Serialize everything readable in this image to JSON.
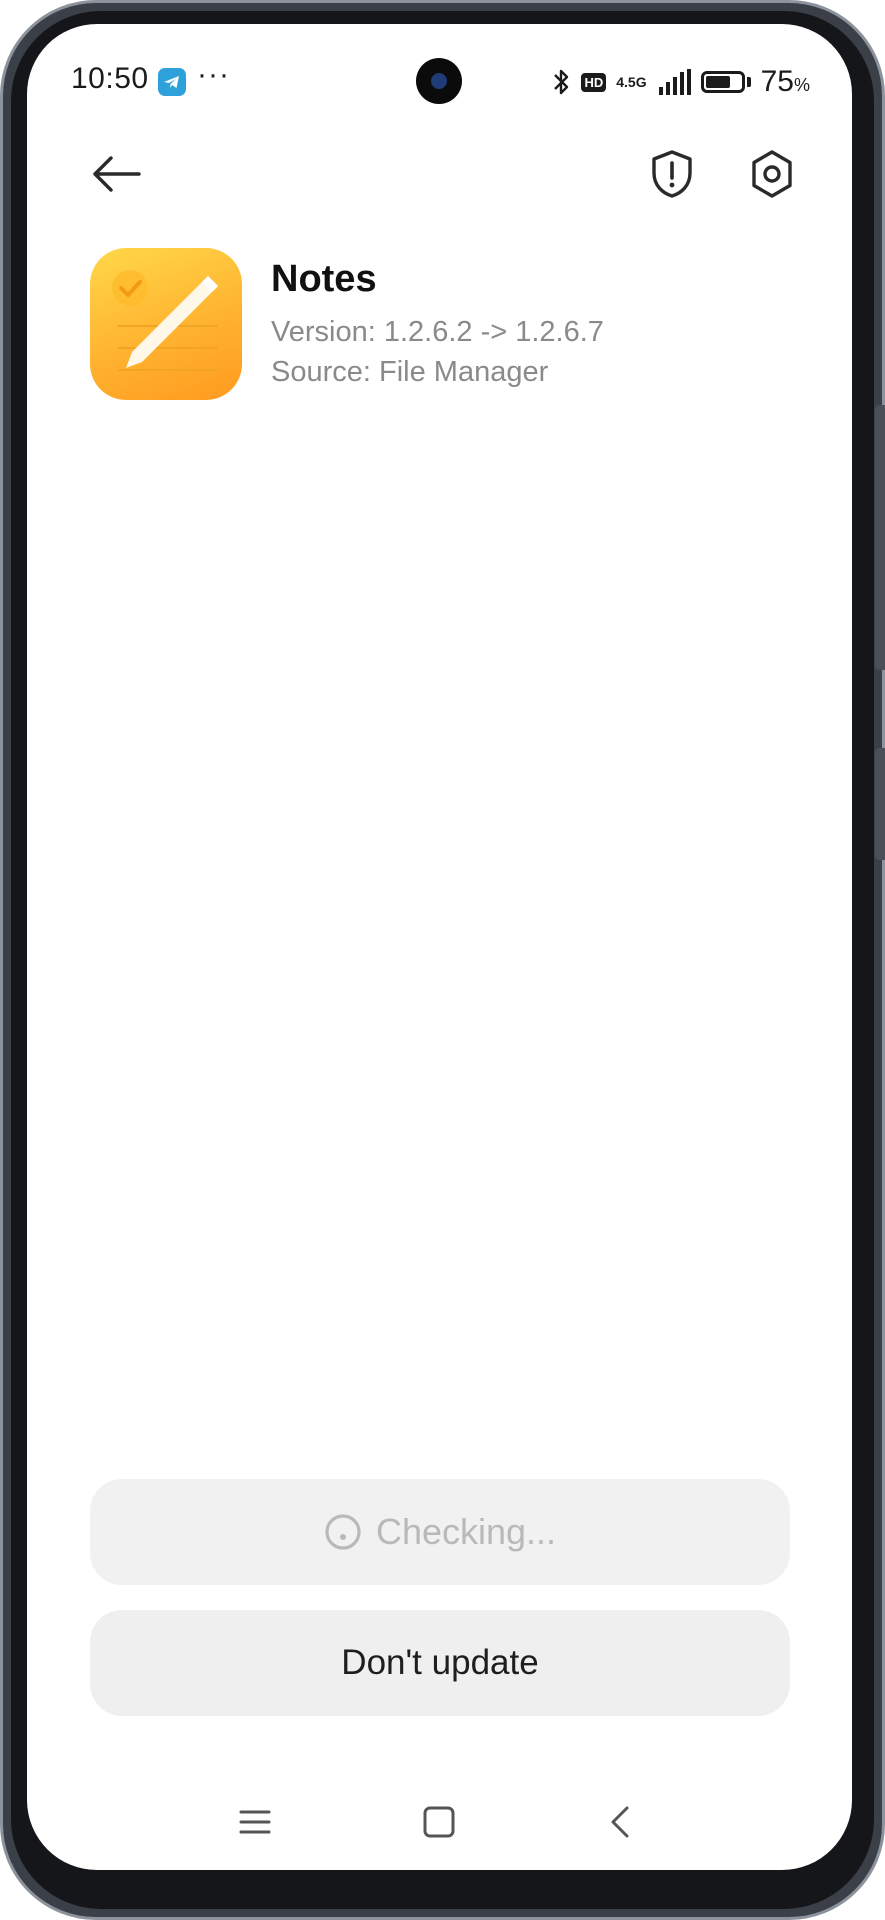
{
  "status_bar": {
    "time": "10:50",
    "notification_dots": "···",
    "hd_label": "HD",
    "network_label": "4.5G",
    "battery_level": 0.75,
    "battery_text": "75",
    "battery_unit": "%"
  },
  "header": {
    "back_icon": "arrow-left-icon",
    "shield_icon": "shield-alert-icon",
    "settings_icon": "hexagon-gear-icon"
  },
  "app": {
    "name": "Notes",
    "version": "Version: 1.2.6.2 -> 1.2.6.7",
    "source": "Source: File Manager",
    "icon": "notes-pencil-icon"
  },
  "actions": {
    "checking_label": "Checking...",
    "dont_update_label": "Don't update"
  },
  "nav_bar": {
    "menu_icon": "menu-lines-icon",
    "home_icon": "square-home-icon",
    "back_icon": "chevron-left-icon"
  },
  "colors": {
    "icon_gradient_top": "#ffd84a",
    "icon_gradient_bottom": "#ff9b1f",
    "button_bg": "#f1f1f1",
    "disabled_text": "#b9b9b9",
    "telegram_blue": "#2ea1db"
  }
}
